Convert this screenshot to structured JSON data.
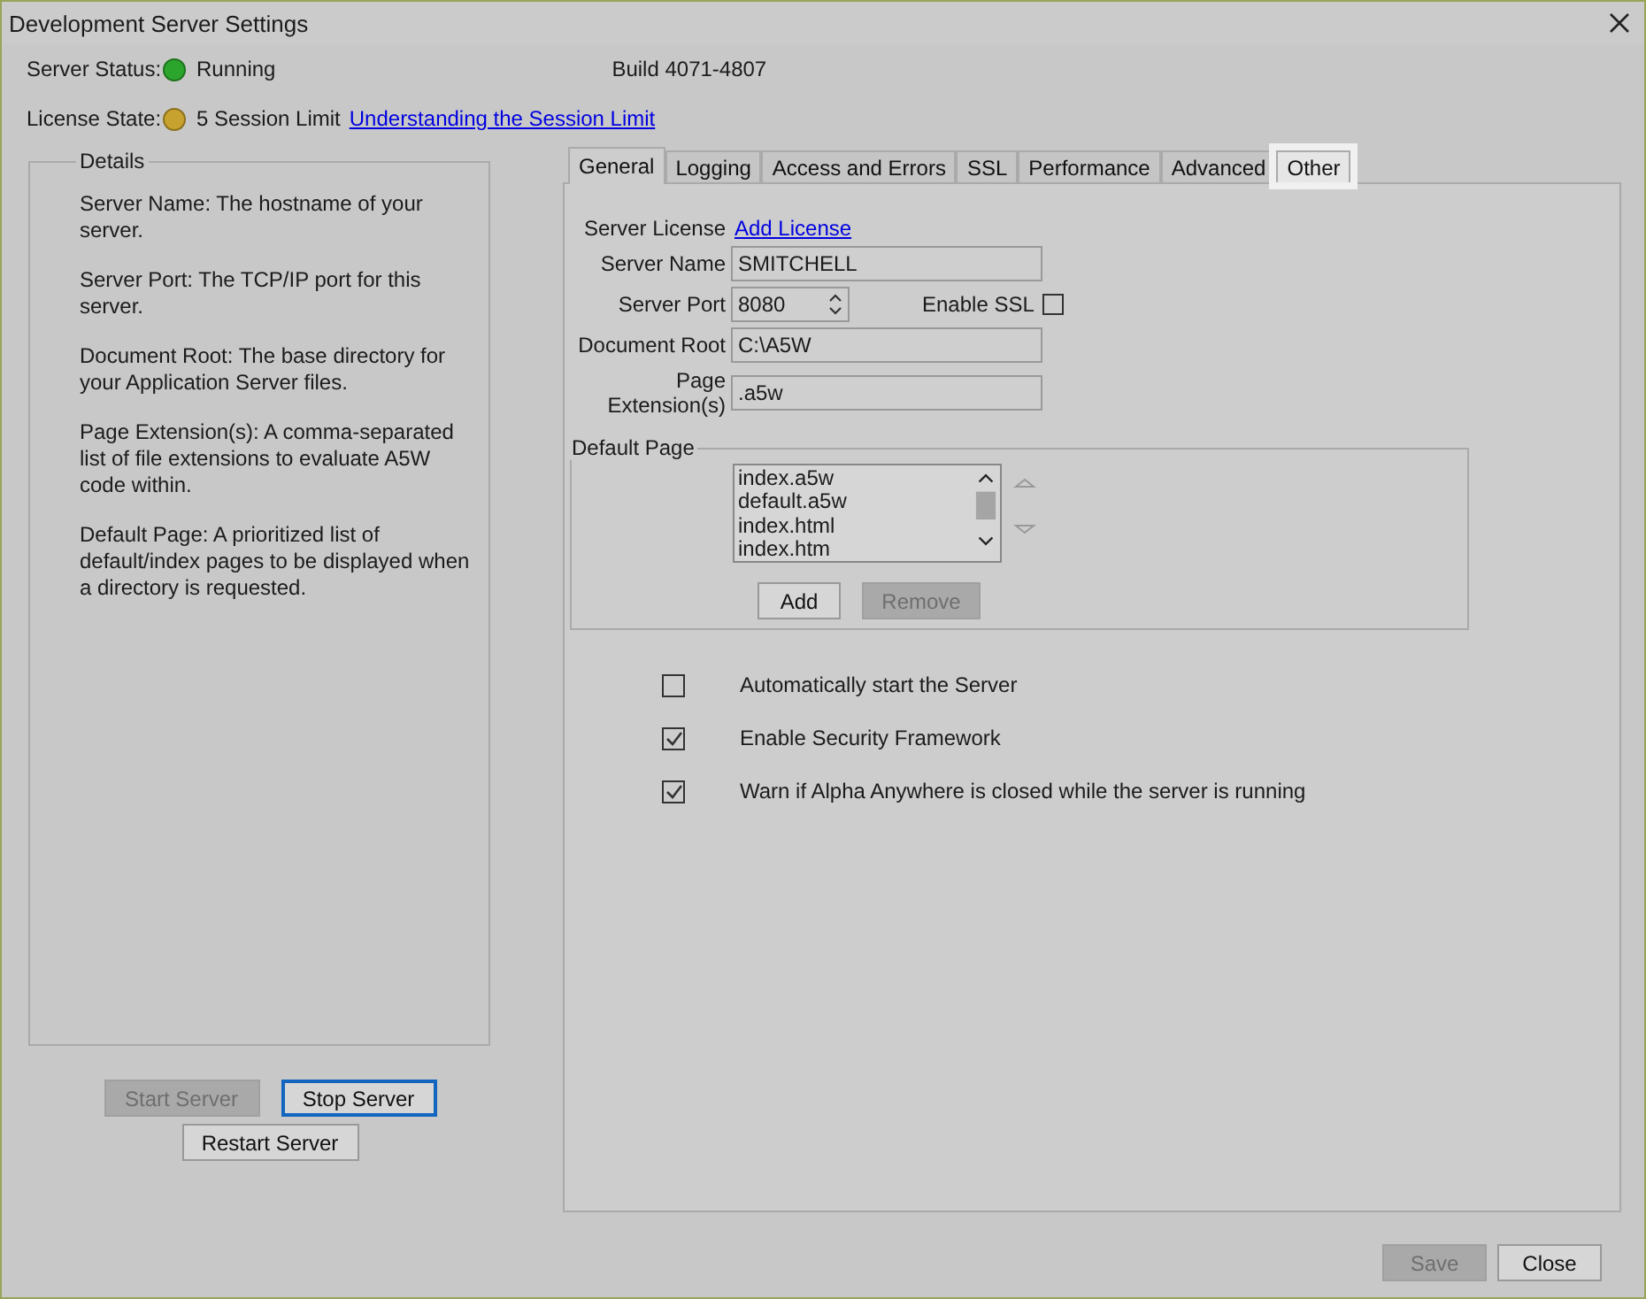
{
  "window": {
    "title": "Development Server Settings"
  },
  "server_status": {
    "label": "Server Status:",
    "color": "#2ca52c",
    "value": "Running"
  },
  "build": "Build 4071-4807",
  "license_state": {
    "label": "License State:",
    "color": "#c8a22e",
    "value": "5 Session Limit",
    "link": "Understanding the Session Limit"
  },
  "details": {
    "title": "Details",
    "paragraphs": [
      "Server Name: The hostname of your server.",
      "Server Port: The TCP/IP port for this server.",
      "Document Root: The base directory for your Application Server files.",
      "Page Extension(s): A comma-separated list of file extensions to evaluate A5W code within.",
      "Default Page: A prioritized list of default/index pages to be displayed when a directory is requested."
    ]
  },
  "server_buttons": [
    {
      "label": "Start Server",
      "disabled": true,
      "focused": false
    },
    {
      "label": "Stop Server",
      "disabled": false,
      "focused": true
    },
    {
      "label": "Restart Server",
      "disabled": false,
      "focused": false
    }
  ],
  "tabs": [
    {
      "label": "General",
      "selected": true,
      "highlighted": false
    },
    {
      "label": "Logging",
      "selected": false,
      "highlighted": false
    },
    {
      "label": "Access and Errors",
      "selected": false,
      "highlighted": false
    },
    {
      "label": "SSL",
      "selected": false,
      "highlighted": false
    },
    {
      "label": "Performance",
      "selected": false,
      "highlighted": false
    },
    {
      "label": "Advanced",
      "selected": false,
      "highlighted": false
    },
    {
      "label": "Other",
      "selected": false,
      "highlighted": true
    }
  ],
  "general": {
    "license": {
      "label": "Server License",
      "link": "Add License"
    },
    "fields": [
      {
        "label": "Server Name",
        "value": "SMITCHELL",
        "kind": "text"
      },
      {
        "label": "Server Port",
        "value": "8080",
        "kind": "spinner"
      },
      {
        "label": "Document Root",
        "value": "C:\\A5W",
        "kind": "text"
      },
      {
        "label": "Page Extension(s)",
        "value": ".a5w",
        "kind": "text"
      }
    ],
    "enable_ssl": {
      "label": "Enable SSL",
      "checked": false
    },
    "default_page": {
      "title": "Default Page",
      "items": [
        "index.a5w",
        "default.a5w",
        "index.html",
        "index.htm"
      ],
      "buttons": [
        {
          "label": "Add",
          "disabled": false
        },
        {
          "label": "Remove",
          "disabled": true
        }
      ]
    },
    "options": [
      {
        "label": "Automatically start the Server",
        "checked": false
      },
      {
        "label": "Enable Security Framework",
        "checked": true
      },
      {
        "label": "Warn if Alpha Anywhere is closed while the server is running",
        "checked": true
      }
    ]
  },
  "footer_buttons": [
    {
      "label": "Save",
      "disabled": true
    },
    {
      "label": "Close",
      "disabled": false
    }
  ]
}
